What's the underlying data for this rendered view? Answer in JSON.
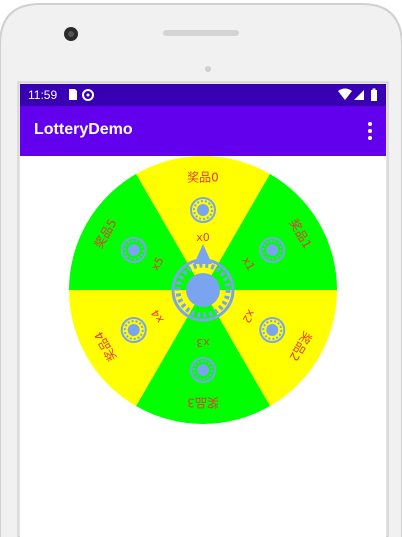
{
  "status_bar": {
    "time": "11:59",
    "icons": [
      "sim-card-icon",
      "sync-icon",
      "wifi-icon",
      "signal-icon",
      "battery-icon"
    ]
  },
  "app_bar": {
    "title": "LotteryDemo",
    "menu_icon": "more-vert-icon"
  },
  "wheel": {
    "prizes": [
      "奖品0",
      "奖品1",
      "奖品2",
      "奖品3",
      "奖品4",
      "奖品5"
    ],
    "multipliers": [
      "x0",
      "x1",
      "x2",
      "x3",
      "x4",
      "x5"
    ],
    "colors": [
      "#FFFF00",
      "#00FF00",
      "#FFFF00",
      "#00FF00",
      "#FFFF00",
      "#00FF00"
    ],
    "icon_color": "#7BA4F0",
    "center_button_color": "#7BA4F0"
  }
}
